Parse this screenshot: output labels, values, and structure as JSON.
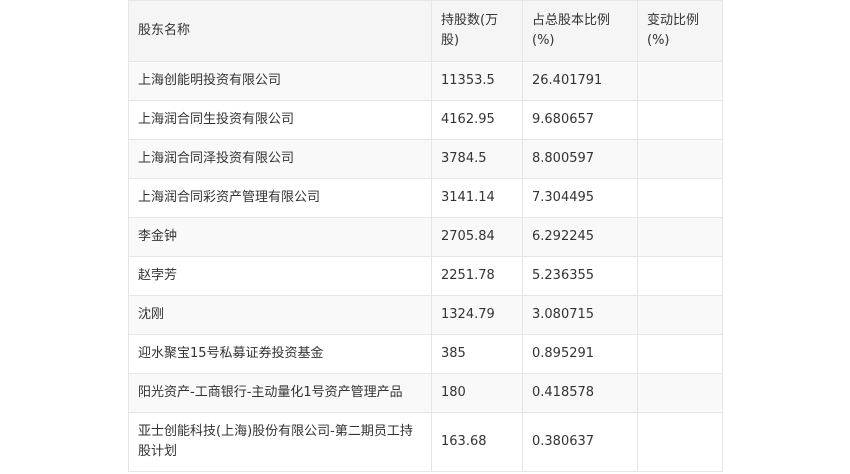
{
  "table": {
    "headers": [
      "股东名称",
      "持股数(万股)",
      "占总股本比例(%)",
      "变动比例(%)"
    ],
    "rows": [
      {
        "name": "上海创能明投资有限公司",
        "shares": "11353.5",
        "ratio": "26.401791",
        "change": ""
      },
      {
        "name": "上海润合同生投资有限公司",
        "shares": "4162.95",
        "ratio": "9.680657",
        "change": ""
      },
      {
        "name": "上海润合同泽投资有限公司",
        "shares": "3784.5",
        "ratio": "8.800597",
        "change": ""
      },
      {
        "name": "上海润合同彩资产管理有限公司",
        "shares": "3141.14",
        "ratio": "7.304495",
        "change": ""
      },
      {
        "name": "李金钟",
        "shares": "2705.84",
        "ratio": "6.292245",
        "change": ""
      },
      {
        "name": "赵孛芳",
        "shares": "2251.78",
        "ratio": "5.236355",
        "change": ""
      },
      {
        "name": "沈刚",
        "shares": "1324.79",
        "ratio": "3.080715",
        "change": ""
      },
      {
        "name": "迎水聚宝15号私募证券投资基金",
        "shares": "385",
        "ratio": "0.895291",
        "change": ""
      },
      {
        "name": "阳光资产-工商银行-主动量化1号资产管理产品",
        "shares": "180",
        "ratio": "0.418578",
        "change": ""
      },
      {
        "name": "亚士创能科技(上海)股份有限公司-第二期员工持股计划",
        "shares": "163.68",
        "ratio": "0.380637",
        "change": ""
      }
    ]
  }
}
